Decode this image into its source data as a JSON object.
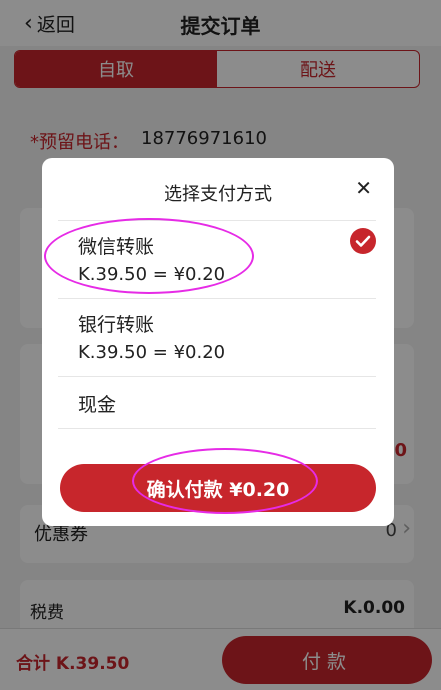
{
  "header": {
    "back_label": "返回",
    "title": "提交订单"
  },
  "delivery_tabs": [
    {
      "label": "自取",
      "active": true
    },
    {
      "label": "配送",
      "active": false
    }
  ],
  "phone": {
    "label": "*预留电话：",
    "value": "18776971610"
  },
  "coupon": {
    "label": "优惠券",
    "value": "0"
  },
  "tax": {
    "label": "税费",
    "value": "K.0.00"
  },
  "partial_price": "0",
  "bottom_bar": {
    "total": "合计 K.39.50",
    "pay_label": "付款"
  },
  "payment_modal": {
    "title": "选择支付方式",
    "options": [
      {
        "name": "微信转账",
        "rate": "K.39.50 = ¥0.20",
        "selected": true
      },
      {
        "name": "银行转账",
        "rate": "K.39.50 = ¥0.20",
        "selected": false
      },
      {
        "name": "现金",
        "rate": "",
        "selected": false
      }
    ],
    "confirm_label": "确认付款 ¥0.20"
  },
  "colors": {
    "accent": "#c7262c",
    "annotation": "#e62be6"
  }
}
